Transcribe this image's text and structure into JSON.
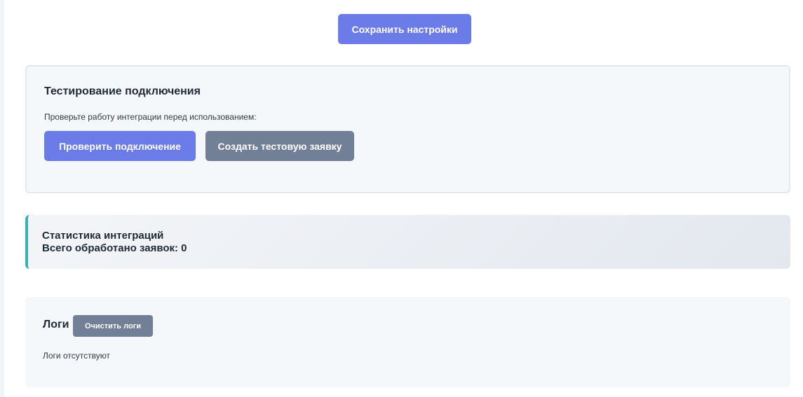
{
  "header": {
    "save_label": "Сохранить настройки"
  },
  "test_section": {
    "title": "Тестирование подключения",
    "description": "Проверьте работу интеграции перед использованием:",
    "check_label": "Проверить подключение",
    "create_label": "Создать тестовую заявку"
  },
  "stats_section": {
    "title": "Статистика интеграций",
    "total_text": "Всего обработано заявок: 0"
  },
  "logs_section": {
    "title": "Логи",
    "clear_label": "Очистить логи",
    "empty_text": "Логи отсутствуют"
  },
  "colors": {
    "primary": "#6b7ce9",
    "secondary": "#718096",
    "accent_border": "#38b2ac",
    "card_bg": "#f5f8fb"
  }
}
